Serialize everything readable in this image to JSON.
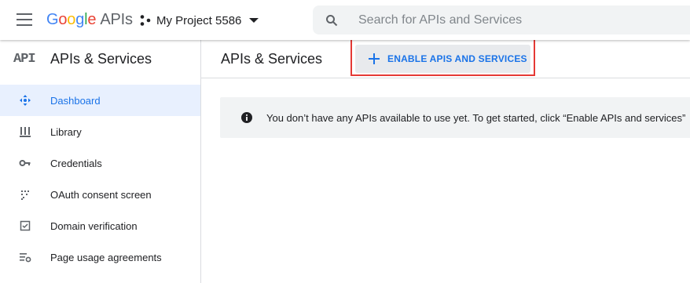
{
  "header": {
    "logo": {
      "letters": [
        "G",
        "o",
        "o",
        "g",
        "l",
        "e"
      ],
      "suffix": "APIs"
    },
    "project_name": "My Project 5586",
    "search_placeholder": "Search for APIs and Services"
  },
  "sidebar": {
    "badge": "API",
    "title": "APIs & Services",
    "items": [
      {
        "label": "Dashboard",
        "icon": "dashboard-icon",
        "active": true
      },
      {
        "label": "Library",
        "icon": "library-icon"
      },
      {
        "label": "Credentials",
        "icon": "key-icon"
      },
      {
        "label": "OAuth consent screen",
        "icon": "oauth-consent-icon"
      },
      {
        "label": "Domain verification",
        "icon": "checkbox-icon"
      },
      {
        "label": "Page usage agreements",
        "icon": "settings-list-icon"
      }
    ]
  },
  "main": {
    "title": "APIs & Services",
    "enable_button": "ENABLE APIS AND SERVICES",
    "notice": "You don’t have any APIs available to use yet. To get started, click “Enable APIs and services”"
  },
  "colors": {
    "accent": "#1a73e8",
    "highlight": "#e53935",
    "active_bg": "#e8f0fe"
  }
}
